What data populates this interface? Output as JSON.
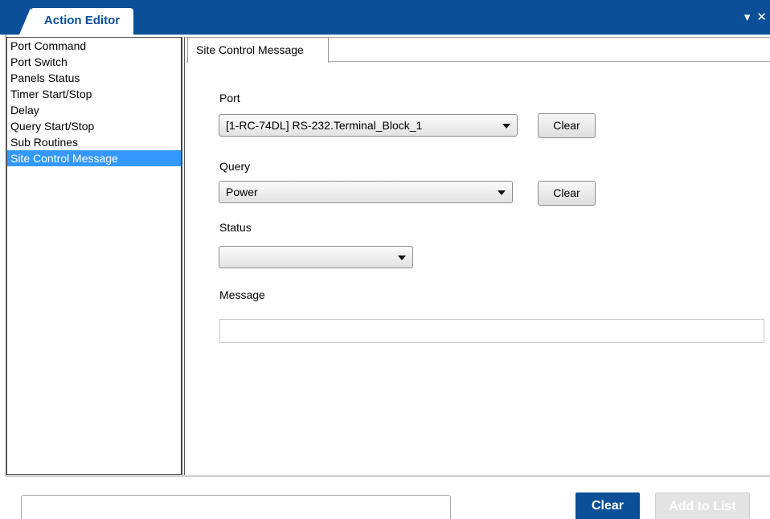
{
  "window": {
    "title": "Action Editor",
    "icons": [
      "dropdown-arrow-icon",
      "close-icon"
    ]
  },
  "sidebar": {
    "items": [
      {
        "label": "Port Command",
        "selected": false
      },
      {
        "label": "Port Switch",
        "selected": false
      },
      {
        "label": "Panels Status",
        "selected": false
      },
      {
        "label": "Timer Start/Stop",
        "selected": false
      },
      {
        "label": "Delay",
        "selected": false
      },
      {
        "label": "Query Start/Stop",
        "selected": false
      },
      {
        "label": "Sub Routines",
        "selected": false
      },
      {
        "label": "Site Control Message",
        "selected": true
      }
    ]
  },
  "main": {
    "tab": {
      "label": "Site Control Message"
    },
    "port": {
      "label": "Port",
      "value": "[1-RC-74DL] RS-232.Terminal_Block_1",
      "clear_label": "Clear"
    },
    "query": {
      "label": "Query",
      "value": "Power",
      "clear_label": "Clear"
    },
    "status": {
      "label": "Status",
      "value": ""
    },
    "message": {
      "label": "Message",
      "value": ""
    }
  },
  "footer": {
    "input_value": "",
    "clear_label": "Clear",
    "add_label": "Add to List"
  },
  "colors": {
    "brand": "#0a4f98",
    "selection": "#3399ff"
  }
}
